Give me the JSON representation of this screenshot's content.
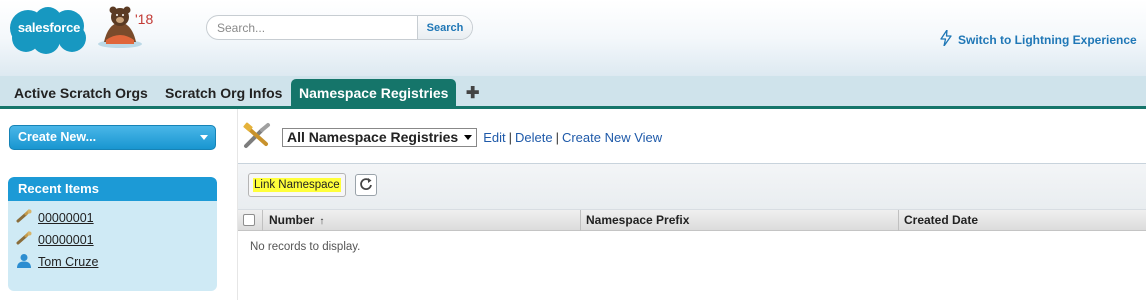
{
  "header": {
    "logo_text": "salesforce",
    "mascot_year": "'18",
    "search": {
      "placeholder": "Search...",
      "button_label": "Search"
    },
    "lightning_link": "Switch to Lightning Experience"
  },
  "tabs": [
    {
      "label": "Active Scratch Orgs",
      "active": false
    },
    {
      "label": "Scratch Org Infos",
      "active": false
    },
    {
      "label": "Namespace Registries",
      "active": true
    }
  ],
  "sidebar": {
    "create_new_label": "Create New...",
    "recent_items_title": "Recent Items",
    "recent_items": [
      {
        "label": "00000001",
        "icon": "wrench-icon"
      },
      {
        "label": "00000001",
        "icon": "wrench-icon"
      },
      {
        "label": "Tom Cruze",
        "icon": "user-icon"
      }
    ]
  },
  "main": {
    "view_selector": "All Namespace Registries",
    "view_links": {
      "edit": "Edit",
      "delete": "Delete",
      "create": "Create New View"
    },
    "toolbar": {
      "link_namespace_label": "Link Namespace"
    },
    "columns": [
      {
        "label": "Number",
        "sorted": "asc"
      },
      {
        "label": "Namespace Prefix"
      },
      {
        "label": "Created Date"
      }
    ],
    "empty_message": "No records to display."
  },
  "colors": {
    "tab_accent": "#15756a",
    "link_blue": "#1f5aa9",
    "sidebar_blue": "#1c9ad6",
    "highlight_yellow": "#ffff3a"
  }
}
